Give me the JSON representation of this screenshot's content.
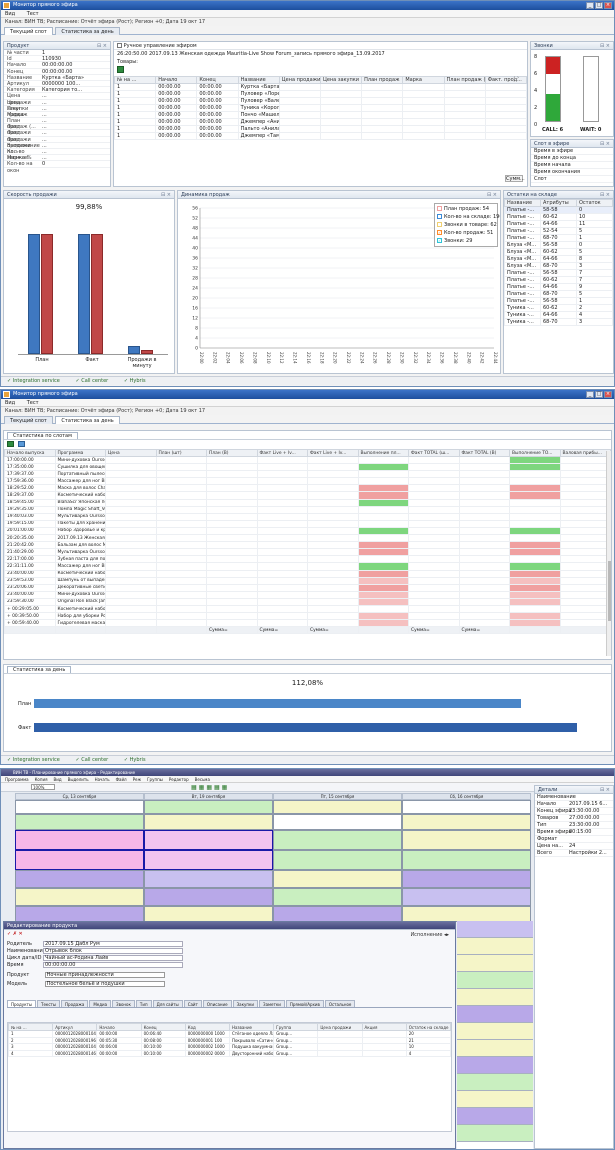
{
  "window1": {
    "title": "Монитор прямого эфира",
    "menu": [
      "Вид",
      "Тест"
    ],
    "channel_line": "Канал: ВИН ТВ; Расписание: Отчёт эфира (Рост); Регион +0; Дата 19 окт 17",
    "tabs": [
      "Текущий слот",
      "Статистика за день"
    ],
    "product_panel": {
      "title": "Продукт",
      "fields": [
        {
          "k": "№ части",
          "v": "1"
        },
        {
          "k": "Id",
          "v": "110930"
        },
        {
          "k": "Начало",
          "v": "00:00:00.00"
        },
        {
          "k": "Конец",
          "v": "00:00:00.00"
        },
        {
          "k": "Название",
          "v": "Куртка «Барта»"
        },
        {
          "k": "Артикул",
          "v": "0000000 100..."
        },
        {
          "k": "Категория",
          "v": "Категория то..."
        },
        {
          "k": "Цена продажи",
          "v": "..."
        },
        {
          "k": "Цена закупки",
          "v": "..."
        },
        {
          "k": "План продаж",
          "v": "..."
        },
        {
          "k": "Марка",
          "v": "..."
        },
        {
          "k": "План продаж (...",
          "v": "..."
        },
        {
          "k": "Факт. продажи",
          "v": "..."
        },
        {
          "k": "Факт. продажи",
          "v": "..."
        },
        {
          "k": "Факт. продажи",
          "v": "..."
        },
        {
          "k": "Выполнение пл...",
          "v": "..."
        },
        {
          "k": "Кол-во звонков",
          "v": "..."
        },
        {
          "k": "Маржа %",
          "v": "..."
        },
        {
          "k": "Кол-во на окон",
          "v": "0"
        }
      ]
    },
    "manual_control": "Ручное управление эфиром",
    "broadcast_line": "26:20:50.00 2017.09.13 Женская одежда Mauritia-Live Show Forum_запись прямого эфира_13.09.2017",
    "goods_label": "Товары:",
    "goods_table": {
      "headers": [
        "№ на ...",
        "Начало",
        "Конец",
        "Название",
        "Цена продажи",
        "Цена закупки",
        "План продаж",
        "Марка",
        "План продаж (...",
        "Факт. прод..."
      ],
      "rows": [
        [
          "1",
          "00:00.00",
          "00:00.00",
          "Куртка «Барта»"
        ],
        [
          "1",
          "00:00.00",
          "00:00.00",
          "Пуловер «Лоретто»"
        ],
        [
          "1",
          "00:00.00",
          "00:00.00",
          "Пуловер «Валерия»"
        ],
        [
          "1",
          "00:00.00",
          "00:00.00",
          "Туника «Королина»"
        ],
        [
          "1",
          "00:00.00",
          "00:00.00",
          "Пончо «Машель»"
        ],
        [
          "1",
          "00:00.00",
          "00:00.00",
          "Джемпер «Анида», розер..."
        ],
        [
          "1",
          "00:00.00",
          "00:00.00",
          "Пальто «Анила»"
        ],
        [
          "1",
          "00:00.00",
          "00:00.00",
          "Джемпер «Тамила»"
        ]
      ]
    },
    "calls_panel": {
      "title": "Звонки",
      "axis": [
        "8",
        "6",
        "4",
        "2",
        "0"
      ],
      "call_label": "CALL: 6",
      "wait_label": "WAIT: 0",
      "call_value": 6,
      "max": 8
    },
    "broadcast_slot": {
      "title": "Слот в эфире",
      "items": [
        "Время в эфире",
        "Время до конца",
        "Время начала",
        "Время окончания",
        "Слот"
      ]
    },
    "speed_panel": {
      "title": "Скорость продажи",
      "percent": "99,88%",
      "bars": [
        {
          "label": "План",
          "blue": 92,
          "red": 92
        },
        {
          "label": "Факт",
          "blue": 92,
          "red": 92
        },
        {
          "label": "Продажи в минуту",
          "blue": 6,
          "red": 3
        }
      ]
    },
    "dynamics_panel": {
      "title": "Динамика продаж",
      "legend": [
        {
          "name": "План продаж: 54",
          "color": "#f0a0a0",
          "checked": false
        },
        {
          "name": "Кол-во на складе: 196",
          "color": "#3b8bd8",
          "checked": false
        },
        {
          "name": "Звонки в товаре: 62",
          "color": "#f0d070",
          "checked": false
        },
        {
          "name": "Кол-во продаж: 51",
          "color": "#ff8c2a",
          "checked": true
        },
        {
          "name": "Звонки: 29",
          "color": "#2ec4d8",
          "checked": true
        }
      ],
      "y_ticks": [
        "56",
        "52",
        "48",
        "44",
        "40",
        "36",
        "32",
        "28",
        "24",
        "20",
        "16",
        "12",
        "8",
        "4",
        "0"
      ],
      "x_ticks": [
        "22:00",
        "22:02",
        "22:04",
        "22:06",
        "22:08",
        "22:10",
        "22:12",
        "22:14",
        "22:16",
        "22:18",
        "22:20",
        "22:22",
        "22:24",
        "22:26",
        "22:28",
        "22:30",
        "22:32",
        "22:34",
        "22:36",
        "22:38",
        "22:40",
        "22:42",
        "22:44"
      ]
    },
    "stock_panel": {
      "title": "Остатки на складе",
      "headers": [
        "Название",
        "Атрибуты",
        "Остаток"
      ],
      "rows": [
        [
          "Платье -...",
          "58-58",
          "0"
        ],
        [
          "Платье -...",
          "60-62",
          "10"
        ],
        [
          "Платье -...",
          "64-66",
          "11"
        ],
        [
          "Платье -...",
          "52-54",
          "5"
        ],
        [
          "Платье -...",
          "68-70",
          "1"
        ],
        [
          "Блуза «М...",
          "56-58",
          "0"
        ],
        [
          "Блуза «М...",
          "60-62",
          "5"
        ],
        [
          "Блуза «М...",
          "64-66",
          "8"
        ],
        [
          "Блуза «М...",
          "68-70",
          "3"
        ],
        [
          "Платье -...",
          "56-58",
          "7"
        ],
        [
          "Платье -...",
          "60-62",
          "7"
        ],
        [
          "Платье -...",
          "64-66",
          "9"
        ],
        [
          "Платье -...",
          "68-70",
          "5"
        ],
        [
          "Платье -...",
          "56-58",
          "1"
        ],
        [
          "Туника -...",
          "60-62",
          "2"
        ],
        [
          "Туника -...",
          "64-66",
          "4"
        ],
        [
          "Туника -...",
          "68-70",
          "3"
        ]
      ]
    },
    "status": [
      "Integration service",
      "Call center",
      "Hybris"
    ]
  },
  "window2": {
    "title": "Монитор прямого эфира",
    "menu": [
      "Вид",
      "Тест"
    ],
    "channel_line": "Канал: ВИН ТВ; Расписание: Отчёт эфира (Рост); Регион +0; Дата 19 окт 17",
    "tabs": [
      "Текущий слот",
      "Статистика за день"
    ],
    "subtab": "Статистика по слотам",
    "headers": [
      "Начало выпуска",
      "Программа",
      "Цена",
      "План (шт)",
      "План (В)",
      "Факт Live + Iv...",
      "Факт Live + Iv...",
      "Выполнение пл...",
      "Факт TOTAL (ш...",
      "Факт TOTAL (В)",
      "Выполнение TO...",
      "Валовая прибы..."
    ],
    "rows": [
      [
        "17:00:00.00",
        "Мини-духовка Oursson MO3010/RD ...",
        "",
        "",
        "",
        "",
        "",
        "",
        "",
        "",
        "green",
        ""
      ],
      [
        "17:35:00.00",
        "Сушилка для овощей и фруктов Ро...",
        "",
        "",
        "",
        "",
        "",
        "green",
        "",
        "",
        "green",
        ""
      ],
      [
        "17:39:37.00",
        "Портативный пылесос Polaris (крас...",
        "",
        "",
        "",
        "",
        "",
        "",
        "",
        "",
        "",
        ""
      ],
      [
        "17:59:36.00",
        "Массажер для ног Bliss_Ver 11 Live ...",
        "",
        "",
        "",
        "",
        "",
        "",
        "",
        "",
        "",
        ""
      ],
      [
        "18:29:52.00",
        "Маска для волос Chahong_Ver 06_...",
        "",
        "",
        "",
        "",
        "",
        "red",
        "",
        "",
        "red",
        ""
      ],
      [
        "18:29:37.00",
        "Косметический набор Naturalthera...",
        "",
        "",
        "",
        "",
        "",
        "red",
        "",
        "",
        "red",
        ""
      ],
      [
        "18:59:45.00",
        "BlahaScr Японская посуда и ёмка...",
        "",
        "",
        "",
        "",
        "",
        "green",
        "",
        "",
        "",
        ""
      ],
      [
        "19:29:35.00",
        "Помпа Magic Shaft_Ver 69 Live Show...",
        "",
        "",
        "",
        "",
        "",
        "",
        "",
        "",
        "",
        ""
      ],
      [
        "19:40:03.00",
        "Мультиварка Oursson MS2860_Ver...",
        "",
        "",
        "",
        "",
        "",
        "",
        "",
        "",
        "",
        ""
      ],
      [
        "19:59:15.00",
        "Пакеты для хранения продуктов-...",
        "",
        "",
        "",
        "",
        "",
        "",
        "",
        "",
        "",
        ""
      ],
      [
        "20:01:00.00",
        "Набор Здоровье и красивые ногти...",
        "",
        "",
        "",
        "",
        "",
        "green",
        "",
        "",
        "green",
        ""
      ],
      [
        "20:20:35.00",
        "2017.09.13 Женская одежда Mauri...",
        "",
        "",
        "",
        "",
        "",
        "",
        "",
        "",
        "",
        ""
      ],
      [
        "21:20:42.00",
        "Бальзам для волос Mucota Treatme...",
        "",
        "",
        "",
        "",
        "",
        "red",
        "",
        "",
        "red",
        ""
      ],
      [
        "21:40:29.00",
        "Мультиварка Oursson MP5005PSD_...",
        "",
        "",
        "",
        "",
        "",
        "red",
        "",
        "",
        "red",
        ""
      ],
      [
        "22:17:00.00",
        "Зубная паста для посудомоеч.BBA_...",
        "",
        "",
        "",
        "",
        "",
        "",
        "",
        "",
        "",
        ""
      ],
      [
        "22:31:11.00",
        "Массажер для ног Bliss_Ver 11 Live ...",
        "",
        "",
        "",
        "",
        "",
        "green",
        "",
        "",
        "green",
        ""
      ],
      [
        "23:40:00.00",
        "Косметический набор Naturalthera...",
        "",
        "",
        "",
        "",
        "",
        "red",
        "",
        "",
        "red",
        ""
      ],
      [
        "23:59:53.00",
        "Шампунь от выпадения волос Orig...",
        "",
        "",
        "",
        "",
        "",
        "pink",
        "",
        "",
        "pink",
        ""
      ],
      [
        "23:20:06.00",
        "Декоративные светильники для д...",
        "",
        "",
        "",
        "",
        "",
        "red",
        "",
        "",
        "red",
        ""
      ],
      [
        "23:40:00.00",
        "Мини-духовка Oursson MO3010/RD ...",
        "",
        "",
        "",
        "",
        "",
        "pink",
        "",
        "",
        "pink",
        ""
      ],
      [
        "23:59:30.00",
        "Original Ron Black Jam Cream (Сре...",
        "",
        "",
        "",
        "",
        "",
        "pink",
        "",
        "",
        "pink",
        ""
      ],
      [
        "+ 00:29:05.00",
        "Косметический набор Naturalthera...",
        "",
        "",
        "",
        "",
        "",
        "",
        "",
        "",
        "",
        ""
      ],
      [
        "+ 00:39:50.00",
        "Набор для уборки Polaris_Ver 01 Liv...",
        "",
        "",
        "",
        "",
        "",
        "pink",
        "",
        "",
        "pink",
        ""
      ],
      [
        "+ 00:59:40.00",
        "Гидрогелевая маска Coldema_Ver ...",
        "",
        "",
        "",
        "",
        "",
        "pink",
        "",
        "",
        "pink",
        ""
      ]
    ],
    "totals": [
      "Сумма=",
      "Сумма=",
      "Сумма=",
      "Сумма=",
      "Сумма="
    ],
    "day_stats": {
      "title": "Статистика за день",
      "percent": "112,08%",
      "plan_label": "План",
      "fact_label": "Факт",
      "plan_value": 0.87,
      "fact_value": 0.97
    },
    "status": [
      "Integration service",
      "Call center",
      "Hybris"
    ]
  },
  "window3": {
    "title": "ВИН ТВ - Планирование прямого эфира - Редактирование",
    "menu": [
      "Программа",
      "Копия",
      "Вид",
      "Выделить",
      "Начать",
      "Файл",
      "Реж",
      "Группы",
      "Редактор",
      "Весьма"
    ],
    "toolbar_zoom": "100%",
    "columns": [
      "Ср, 13 сентября",
      "Вт, 19 сентября",
      "Пт, 15 сентября",
      "Сб, 16 сентября"
    ],
    "dialog": {
      "title": "Редактирование продукта",
      "tabs": [
        "Продукты",
        "Тексты",
        "Продажа",
        "Медиа",
        "Звонок",
        "Тип",
        "Для сайты",
        "Сайт",
        "Описание",
        "Закупки",
        "Заметки",
        "Прямой/Архив",
        "Остальное"
      ],
      "fields": [
        {
          "k": "Родитель",
          "v": "2017.09.15 Дабл Рум"
        },
        {
          "k": "Наименование",
          "v": "Отрывок блок"
        },
        {
          "k": "Цикл дата/ID",
          "v": "Чайный ас-Родина Лайв"
        },
        {
          "k": "Время",
          "v": "00:00:00.00"
        }
      ],
      "product_label": "Продукт",
      "product_value": "Ночные принадлежности",
      "series_label": "Модель",
      "series_value": "Постельное бельё и подушки",
      "table_headers": [
        "№ на ...",
        "Артикул",
        "Начало",
        "Конец",
        "Код",
        "Название",
        "Группа",
        "Цена продажи",
        "Акция",
        "Остаток на складе"
      ],
      "table_rows": [
        [
          "1",
          "0000012028000104",
          "00:00:00",
          "00:06:40",
          "0000000000 1000",
          "Стёганое одеяло Лайт и перья Ленбаттиско-Ролет 3.5×0",
          "Group...",
          "",
          "",
          "20"
        ],
        [
          "2",
          "0000012028000196",
          "00:05:30",
          "00:08:00",
          "0000000001 100",
          "Покрывало «Сатин» Сакантоль-Луза для 3.5х 1.5",
          "Group...",
          "",
          "",
          "21"
        ],
        [
          "3",
          "0000012028000104",
          "00:06:00",
          "00:10:00",
          "0000000002 1000",
          "Подушка вакуумная «Dr» А-Шарпет 2 для 2м",
          "Group...",
          "",
          "",
          "10"
        ],
        [
          "4",
          "0000012028000146",
          "00:00:00",
          "00:10:00",
          "0000000002 0000",
          "Двусторонний набор постельного белья дл Лаунет",
          "Group...",
          "",
          "",
          "4"
        ]
      ]
    },
    "right_panel": {
      "title": "Детали",
      "fields": [
        {
          "k": "Наименование",
          "v": ""
        },
        {
          "k": "Начало",
          "v": "2017.09.15 6..."
        },
        {
          "k": "Конец эфира",
          "v": "23:30:00.00"
        },
        {
          "k": "Товаров",
          "v": "27:00:00.00"
        },
        {
          "k": "Тип",
          "v": "23:30:00.00"
        },
        {
          "k": "Время эфира",
          "v": "00:15:00"
        },
        {
          "k": "Формат",
          "v": ""
        },
        {
          "k": "Цена на...",
          "v": "24"
        },
        {
          "k": "Всего",
          "v": "Настройки 2..."
        }
      ]
    }
  }
}
